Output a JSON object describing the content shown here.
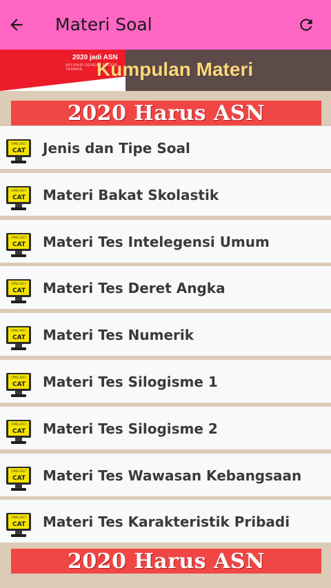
{
  "appbar": {
    "title": "Materi Soal",
    "back_icon": "arrow-left-icon",
    "refresh_icon": "refresh-icon",
    "background": "#ff66c4"
  },
  "top_banner": {
    "tag": "2020 jadi ASN",
    "subtag": "APLIKASI DENGAN MATERI TERBAIK",
    "caption": "Kumpulan Materi"
  },
  "asn_banner": {
    "text": "2020 Harus ASN",
    "color": "#f14646"
  },
  "items": [
    {
      "label": "Jenis dan Tipe Soal",
      "icon": "cat-monitor-icon"
    },
    {
      "label": "Materi Bakat Skolastik",
      "icon": "cat-monitor-icon"
    },
    {
      "label": "Materi Tes Intelegensi Umum",
      "icon": "cat-monitor-icon"
    },
    {
      "label": "Materi Tes Deret Angka",
      "icon": "cat-monitor-icon"
    },
    {
      "label": "Materi Tes Numerik",
      "icon": "cat-monitor-icon"
    },
    {
      "label": "Materi Tes Silogisme 1",
      "icon": "cat-monitor-icon"
    },
    {
      "label": "Materi Tes Silogisme 2",
      "icon": "cat-monitor-icon"
    },
    {
      "label": "Materi Tes Wawasan Kebangsaan",
      "icon": "cat-monitor-icon"
    },
    {
      "label": "Materi Tes Karakteristik Pribadi",
      "icon": "cat-monitor-icon"
    }
  ],
  "cat_icon_text": "CAT",
  "cat_icon_subtext": "CPNS 2017"
}
